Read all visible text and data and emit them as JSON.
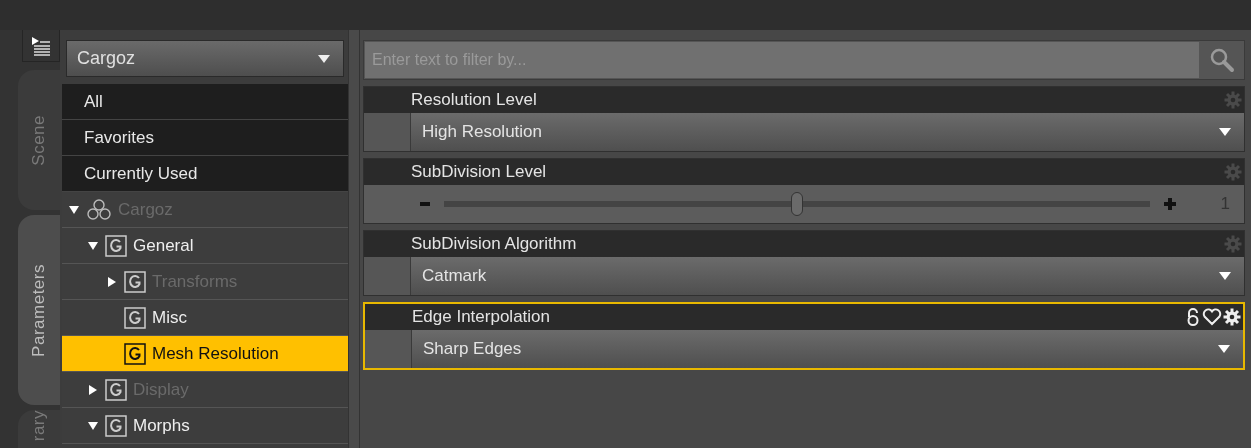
{
  "side_tabs": [
    {
      "label": "Scene",
      "selected": false
    },
    {
      "label": "Parameters",
      "selected": true
    },
    {
      "label": "rary",
      "selected": false
    }
  ],
  "node_selector": {
    "value": "Cargoz"
  },
  "filters": [
    {
      "label": "All"
    },
    {
      "label": "Favorites"
    },
    {
      "label": "Currently Used"
    }
  ],
  "tree": [
    {
      "label": "Cargoz",
      "kind": "figure",
      "expandable": true,
      "expanded": true,
      "dimmed": true,
      "selected": false,
      "children": [
        {
          "label": "General",
          "kind": "group",
          "expandable": true,
          "expanded": true,
          "dimmed": false,
          "selected": false,
          "children": [
            {
              "label": "Transforms",
              "kind": "group",
              "expandable": true,
              "expanded": false,
              "dimmed": true,
              "selected": false
            },
            {
              "label": "Misc",
              "kind": "group",
              "expandable": false,
              "dimmed": false,
              "selected": false
            },
            {
              "label": "Mesh Resolution",
              "kind": "group",
              "expandable": false,
              "dimmed": false,
              "selected": true
            }
          ]
        },
        {
          "label": "Display",
          "kind": "group",
          "expandable": true,
          "expanded": false,
          "dimmed": true,
          "selected": false
        },
        {
          "label": "Morphs",
          "kind": "group",
          "expandable": true,
          "expanded": true,
          "dimmed": false,
          "selected": false
        }
      ]
    }
  ],
  "search": {
    "placeholder": "Enter text to filter by..."
  },
  "properties": [
    {
      "label": "Resolution Level",
      "kind": "dropdown",
      "value": "High Resolution",
      "selected": false
    },
    {
      "label": "SubDivision Level",
      "kind": "slider",
      "level": 0.5,
      "reading": "1",
      "selected": false
    },
    {
      "label": "SubDivision Algorithm",
      "kind": "dropdown",
      "value": "Catmark",
      "selected": false
    },
    {
      "label": "Edge Interpolation",
      "kind": "dropdown",
      "value": "Sharp Edges",
      "selected": true
    }
  ]
}
